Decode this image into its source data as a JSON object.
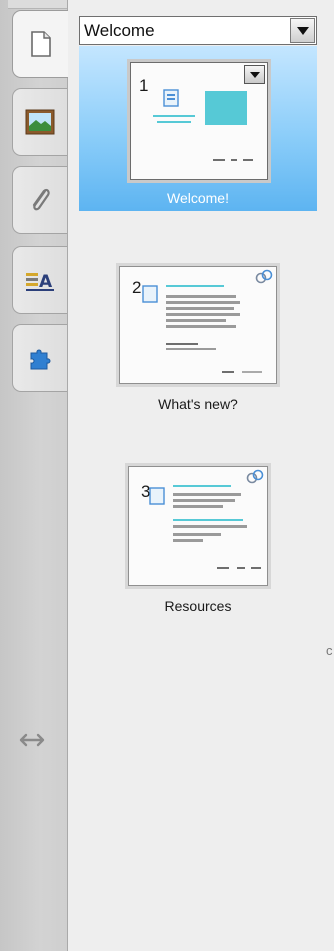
{
  "rail": {
    "tabs": [
      {
        "name": "page-sorter",
        "icon": "page-icon",
        "active": true
      },
      {
        "name": "gallery",
        "icon": "picture-icon",
        "active": false
      },
      {
        "name": "attachments",
        "icon": "paperclip-icon",
        "active": false
      },
      {
        "name": "properties",
        "icon": "text-properties-icon",
        "active": false
      },
      {
        "name": "add-ons",
        "icon": "puzzle-icon",
        "active": false
      }
    ],
    "resize_icon": "resize-arrows-icon"
  },
  "dropdown": {
    "value": "Welcome"
  },
  "pages": [
    {
      "number": "1",
      "label": "Welcome!",
      "selected": true
    },
    {
      "number": "2",
      "label": "What's new?",
      "selected": false
    },
    {
      "number": "3",
      "label": "Resources",
      "selected": false
    }
  ],
  "scroll_hint": "c",
  "colors": {
    "selection": "#8bcdf9",
    "thumb_accent": "#56c9d6",
    "thumb_icon": "#4a8fd6"
  }
}
